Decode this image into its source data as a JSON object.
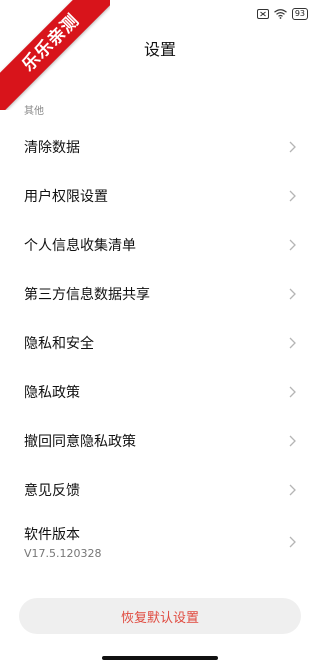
{
  "watermark": "乐乐亲测",
  "status_bar": {
    "battery": "93"
  },
  "header": {
    "title": "设置"
  },
  "section": {
    "title": "其他"
  },
  "items": [
    {
      "label": "清除数据"
    },
    {
      "label": "用户权限设置"
    },
    {
      "label": "个人信息收集清单"
    },
    {
      "label": "第三方信息数据共享"
    },
    {
      "label": "隐私和安全"
    },
    {
      "label": "隐私政策"
    },
    {
      "label": "撤回同意隐私政策"
    },
    {
      "label": "意见反馈"
    }
  ],
  "version": {
    "label": "软件版本",
    "value": "V17.5.120328"
  },
  "reset_button": {
    "label": "恢复默认设置"
  },
  "colors": {
    "accent": "#e04a3f",
    "watermark_bg": "#d8141b"
  },
  "icons": {
    "chevron": "chevron-right-icon",
    "wifi": "wifi-icon",
    "sim": "no-sim-icon",
    "battery": "battery-icon"
  }
}
